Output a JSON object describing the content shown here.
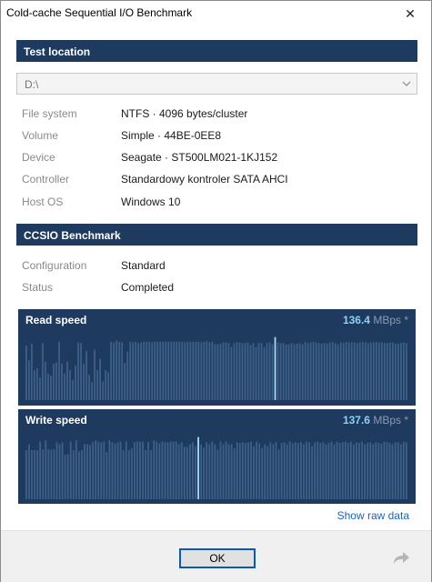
{
  "window": {
    "title": "Cold-cache Sequential I/O Benchmark",
    "close_glyph": "✕"
  },
  "test_location": {
    "header": "Test location",
    "drive_select": {
      "value": "D:\\"
    },
    "rows": [
      {
        "label": "File system",
        "value": "NTFS  ·  4096 bytes/cluster"
      },
      {
        "label": "Volume",
        "value": "Simple  ·  44BE-0EE8"
      },
      {
        "label": "Device",
        "value": "Seagate  ·  ST500LM021-1KJ152"
      },
      {
        "label": "Controller",
        "value": "Standardowy kontroler SATA AHCI"
      },
      {
        "label": "Host OS",
        "value": "Windows 10"
      }
    ]
  },
  "benchmark": {
    "header": "CCSIO Benchmark",
    "rows": [
      {
        "label": "Configuration",
        "value": "Standard"
      },
      {
        "label": "Status",
        "value": "Completed"
      }
    ]
  },
  "read_panel": {
    "title": "Read speed",
    "speed": "136.4",
    "unit": " MBps *",
    "highlight_bar": 91,
    "bars": [
      0.82,
      0.6,
      0.85,
      0.45,
      0.48,
      0.34,
      0.86,
      0.58,
      0.4,
      0.37,
      0.55,
      0.57,
      0.88,
      0.55,
      0.4,
      0.58,
      0.45,
      0.3,
      0.52,
      0.87,
      0.86,
      0.55,
      0.74,
      0.38,
      0.27,
      0.76,
      0.45,
      0.62,
      0.28,
      0.45,
      0.42,
      0.88,
      0.87,
      0.9,
      0.88,
      0.87,
      0.56,
      0.73,
      0.88,
      0.87,
      0.88,
      0.86,
      0.87,
      0.88,
      0.88,
      0.88,
      0.87,
      0.88,
      0.88,
      0.88,
      0.88,
      0.88,
      0.88,
      0.88,
      0.88,
      0.88,
      0.88,
      0.88,
      0.87,
      0.88,
      0.88,
      0.88,
      0.88,
      0.88,
      0.87,
      0.88,
      0.89,
      0.87,
      0.88,
      0.84,
      0.84,
      0.85,
      0.87,
      0.87,
      0.86,
      0.8,
      0.86,
      0.87,
      0.87,
      0.86,
      0.86,
      0.87,
      0.83,
      0.86,
      0.8,
      0.86,
      0.86,
      0.8,
      0.86,
      0.87,
      0.84,
      0.95,
      0.87,
      0.86,
      0.86,
      0.84,
      0.84,
      0.86,
      0.84,
      0.85,
      0.86,
      0.84,
      0.88,
      0.86,
      0.87,
      0.88,
      0.87,
      0.86,
      0.85,
      0.86,
      0.85,
      0.87,
      0.88,
      0.86,
      0.84,
      0.87,
      0.86,
      0.88,
      0.87,
      0.87,
      0.87,
      0.86,
      0.87,
      0.88,
      0.87,
      0.86,
      0.87,
      0.87,
      0.88,
      0.87,
      0.87,
      0.86,
      0.86,
      0.87,
      0.87,
      0.85,
      0.85,
      0.86,
      0.87,
      0.86
    ]
  },
  "write_panel": {
    "title": "Write speed",
    "speed": "137.6",
    "unit": " MBps *",
    "highlight_bar": 62,
    "bars": [
      0.75,
      0.84,
      0.75,
      0.75,
      0.75,
      0.88,
      0.76,
      0.9,
      0.76,
      0.76,
      0.76,
      0.87,
      0.84,
      0.87,
      0.68,
      0.69,
      0.88,
      0.75,
      0.9,
      0.73,
      0.75,
      0.84,
      0.84,
      0.83,
      0.87,
      0.9,
      0.88,
      0.87,
      0.88,
      0.72,
      0.9,
      0.87,
      0.85,
      0.87,
      0.88,
      0.75,
      0.88,
      0.75,
      0.78,
      0.87,
      0.88,
      0.88,
      0.88,
      0.75,
      0.87,
      0.75,
      0.9,
      0.88,
      0.85,
      0.88,
      0.87,
      0.87,
      0.88,
      0.88,
      0.88,
      0.84,
      0.87,
      0.8,
      0.8,
      0.84,
      0.87,
      0.81,
      0.95,
      0.84,
      0.79,
      0.87,
      0.84,
      0.88,
      0.84,
      0.76,
      0.88,
      0.84,
      0.88,
      0.84,
      0.84,
      0.78,
      0.87,
      0.86,
      0.87,
      0.86,
      0.87,
      0.88,
      0.81,
      0.88,
      0.85,
      0.78,
      0.84,
      0.81,
      0.87,
      0.84,
      0.87,
      0.76,
      0.86,
      0.87,
      0.84,
      0.88,
      0.85,
      0.87,
      0.86,
      0.87,
      0.84,
      0.88,
      0.87,
      0.81,
      0.87,
      0.88,
      0.86,
      0.87,
      0.84,
      0.86,
      0.88,
      0.84,
      0.88,
      0.86,
      0.87,
      0.88,
      0.86,
      0.88,
      0.84,
      0.87,
      0.86,
      0.88,
      0.84,
      0.86,
      0.87,
      0.84,
      0.87,
      0.86,
      0.85,
      0.88,
      0.87,
      0.86,
      0.84,
      0.87,
      0.87,
      0.84,
      0.88,
      0.87
    ]
  },
  "footer": {
    "raw_data_link": "Show raw data",
    "ok_label": "OK"
  },
  "colors": {
    "header_bg": "#1e3a5f",
    "bar": "#3d6088",
    "bar_highlight": "#a8dcf5",
    "speed_value": "#8fd0f5"
  },
  "icons": {
    "close": "close-icon",
    "dropdown": "chevron-down-icon",
    "share": "share-arrow-icon"
  }
}
